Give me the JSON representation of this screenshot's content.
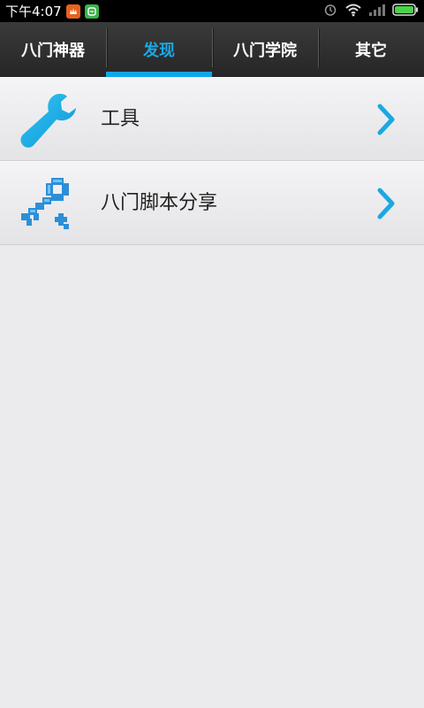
{
  "status_bar": {
    "time": "下午4:07",
    "icons": [
      "app-orange-icon",
      "app-green-icon",
      "alarm-icon",
      "wifi-icon",
      "signal-icon",
      "battery-icon"
    ]
  },
  "tabs": [
    {
      "label": "八门神器",
      "active": false
    },
    {
      "label": "发现",
      "active": true
    },
    {
      "label": "八门学院",
      "active": false
    },
    {
      "label": "其它",
      "active": false
    }
  ],
  "list": [
    {
      "label": "工具",
      "icon": "wrench-icon"
    },
    {
      "label": "八门脚本分享",
      "icon": "key-icon"
    }
  ],
  "colors": {
    "accent": "#10a7e8",
    "tab_bar": "#2e2e2e",
    "background": "#ebebed"
  }
}
